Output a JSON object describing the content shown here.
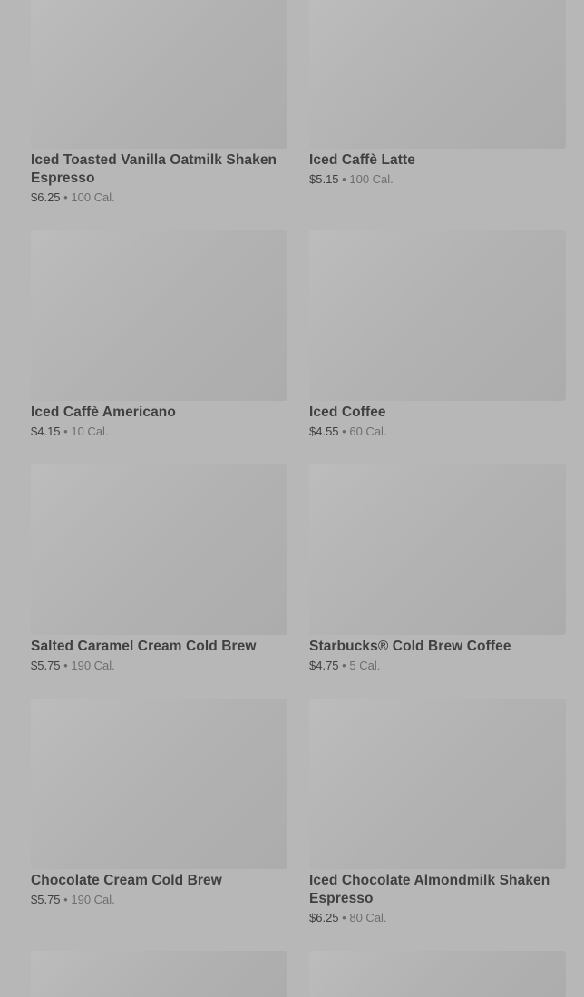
{
  "menu": {
    "items": [
      {
        "name": "Iced Toasted Vanilla Oatmilk Shaken Espresso",
        "price": "$6.25",
        "separator": "•",
        "calories": "100 Cal."
      },
      {
        "name": "Iced Caffè Latte",
        "price": "$5.15",
        "separator": "•",
        "calories": "100 Cal."
      },
      {
        "name": "Iced Caffè Americano",
        "price": "$4.15",
        "separator": "•",
        "calories": "10 Cal."
      },
      {
        "name": "Iced Coffee",
        "price": "$4.55",
        "separator": "•",
        "calories": "60 Cal."
      },
      {
        "name": "Salted Caramel Cream Cold Brew",
        "price": "$5.75",
        "separator": "•",
        "calories": "190 Cal."
      },
      {
        "name": "Starbucks® Cold Brew Coffee",
        "price": "$4.75",
        "separator": "•",
        "calories": "5 Cal."
      },
      {
        "name": "Chocolate Cream Cold Brew",
        "price": "$5.75",
        "separator": "•",
        "calories": "190 Cal."
      },
      {
        "name": "Iced Chocolate Almondmilk Shaken Espresso",
        "price": "$6.25",
        "separator": "•",
        "calories": "80 Cal."
      }
    ]
  }
}
